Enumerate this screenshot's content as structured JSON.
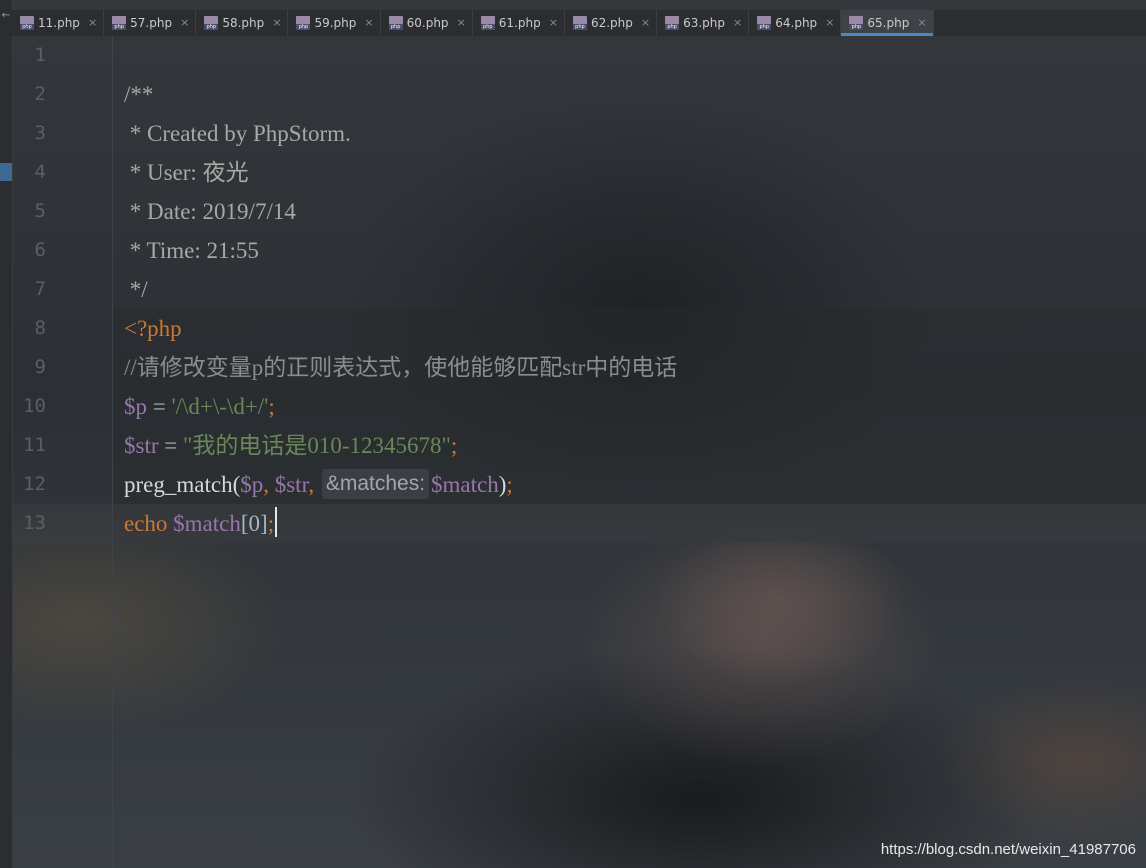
{
  "tabs": [
    {
      "label": "11.php",
      "active": false
    },
    {
      "label": "57.php",
      "active": false
    },
    {
      "label": "58.php",
      "active": false
    },
    {
      "label": "59.php",
      "active": false
    },
    {
      "label": "60.php",
      "active": false
    },
    {
      "label": "61.php",
      "active": false
    },
    {
      "label": "62.php",
      "active": false
    },
    {
      "label": "63.php",
      "active": false
    },
    {
      "label": "64.php",
      "active": false
    },
    {
      "label": "65.php",
      "active": true
    }
  ],
  "file_icon_text": "php",
  "close_glyph": "×",
  "left_arrow": "←",
  "line_numbers": [
    "1",
    "2",
    "3",
    "4",
    "5",
    "6",
    "7",
    "8",
    "9",
    "10",
    "11",
    "12",
    "13"
  ],
  "code": {
    "l2": "/**",
    "l3": " * Created by PhpStorm.",
    "l4": " * User: 夜光",
    "l5": " * Date: 2019/7/14",
    "l6": " * Time: 21:55",
    "l7": " */",
    "l8": "<?php",
    "l9": "//请修改变量p的正则表达式，使他能够匹配str中的电话",
    "l10": {
      "var": "$p",
      "op": " = ",
      "str": "'/\\d+\\-\\d+/'",
      "semi": ";"
    },
    "l11": {
      "var": "$str",
      "op": " = ",
      "str": "\"我的电话是010-12345678\"",
      "semi": ";"
    },
    "l12": {
      "fn": "preg_match(",
      "arg1": "$p",
      "sep1": ", ",
      "arg2": "$str",
      "sep2": ", ",
      "hint": "&matches:",
      "arg3": "$match",
      "close": ")",
      "semi": ";"
    },
    "l13": {
      "kw": "echo",
      "sp": " ",
      "var": "$match",
      "idx": "[0]",
      "semi": ";"
    }
  },
  "watermark": "https://blog.csdn.net/weixin_41987706",
  "colors": {
    "comment": "#a6a9a4",
    "tag": "#cc7832",
    "variable": "#9876aa",
    "string": "#6a8759",
    "active_tab_underline": "#4a88c7"
  }
}
